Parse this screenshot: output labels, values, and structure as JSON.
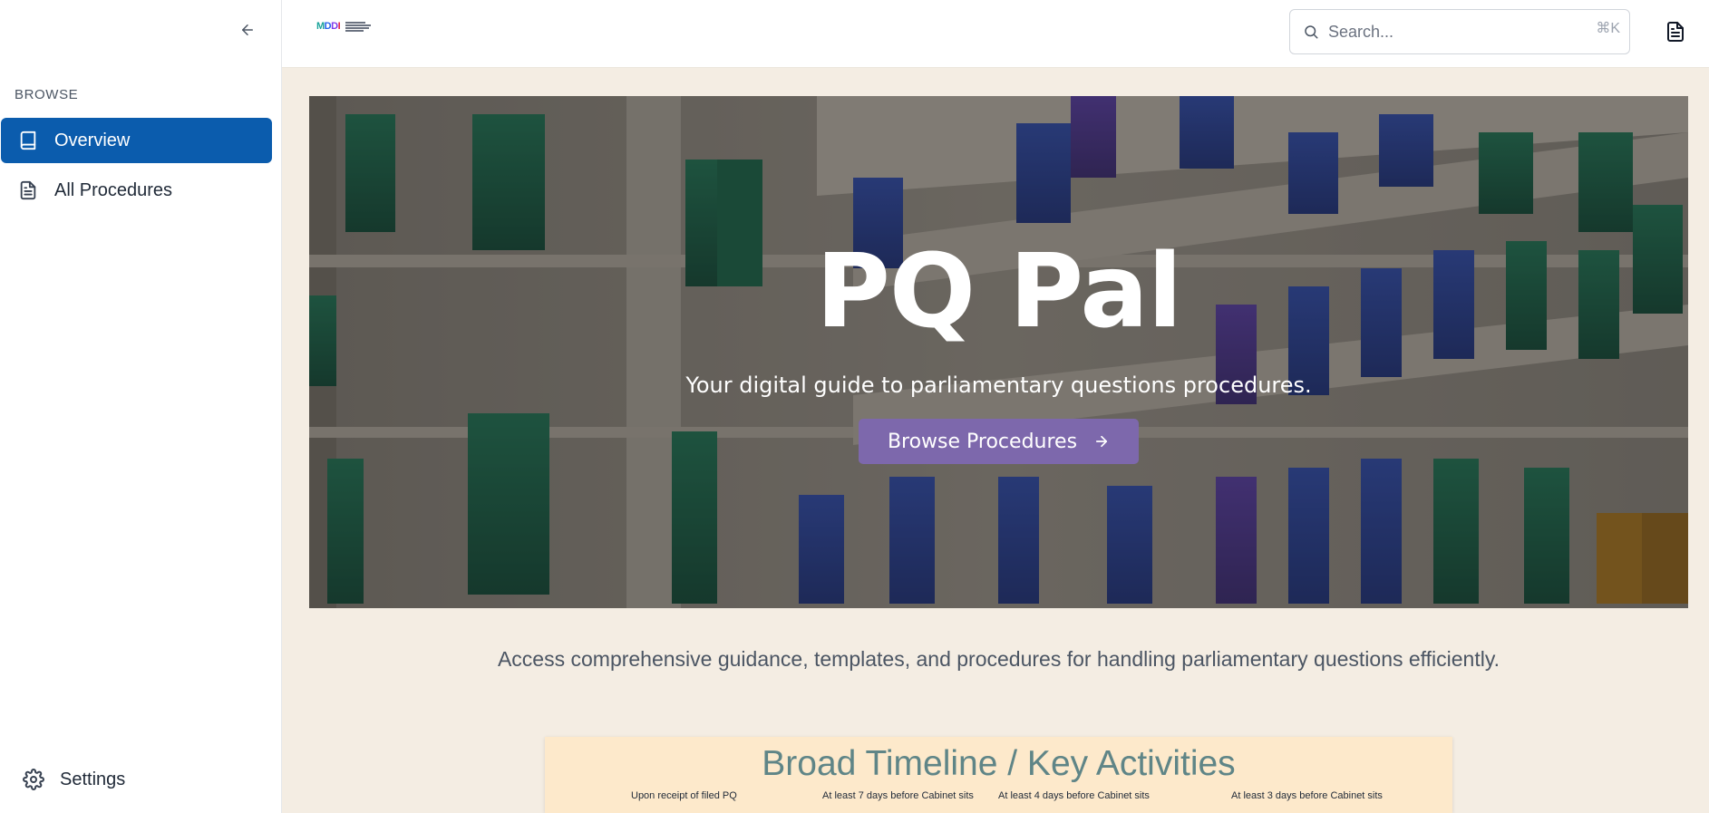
{
  "sidebar": {
    "section_label": "BROWSE",
    "items": [
      {
        "label": "Overview",
        "icon": "book-icon",
        "active": true
      },
      {
        "label": "All Procedures",
        "icon": "document-icon",
        "active": false
      }
    ],
    "settings_label": "Settings"
  },
  "header": {
    "logo_text": "MDDI",
    "search": {
      "placeholder": "Search...",
      "shortcut": "⌘K"
    }
  },
  "hero": {
    "title": "PQ Pal",
    "subtitle": "Your digital guide to parliamentary questions procedures.",
    "cta_label": "Browse Procedures"
  },
  "intro": {
    "text": "Access comprehensive guidance, templates, and procedures for handling parliamentary questions efficiently."
  },
  "timeline": {
    "title": "Broad Timeline / Key Activities",
    "steps": [
      "Upon receipt of filed PQ",
      "At least 7 days before Cabinet sits",
      "At least 4 days before Cabinet sits",
      "At least 3 days before Cabinet sits"
    ]
  },
  "colors": {
    "accent_blue": "#0b5cad",
    "cta_purple": "#7d68ac",
    "page_bg": "#f4ede3",
    "timeline_bg": "#fde9cb"
  }
}
